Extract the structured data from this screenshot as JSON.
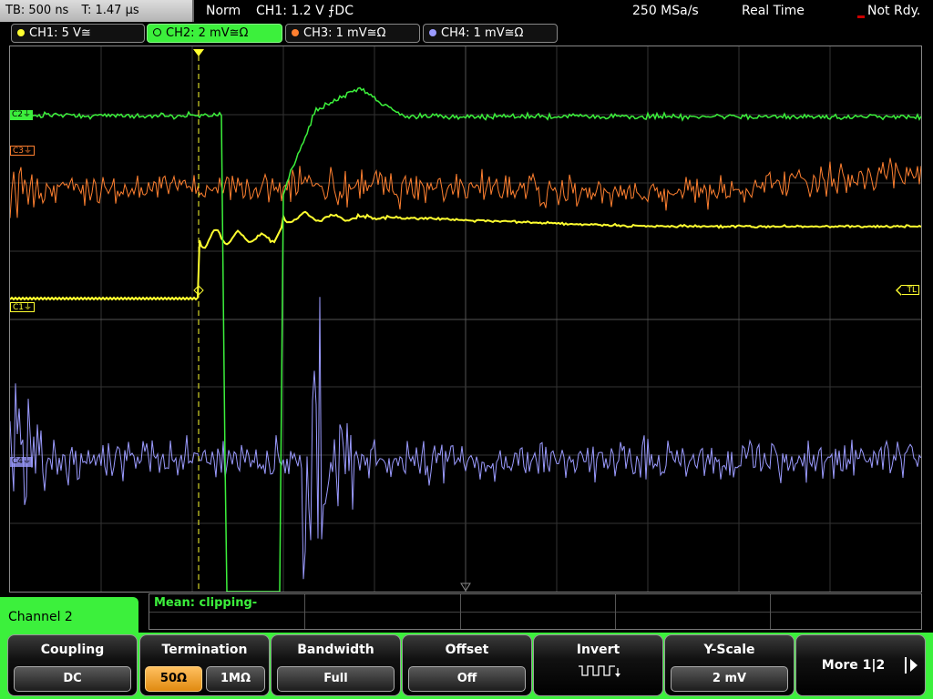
{
  "header": {
    "timebase": "TB: 500 ns",
    "trigger_time": "T: 1.47 µs",
    "trigger_mode": "Norm",
    "trigger_setting": "CH1: 1.2 V ⨍DC",
    "sample_rate": "250 MSa/s",
    "acq_mode": "Real Time",
    "status": "Not Rdy."
  },
  "channel_tabs": [
    {
      "label": "CH1: 5 V≅",
      "color": "#ffff30",
      "active": false
    },
    {
      "label": "CH2: 2 mV≅Ω",
      "color": "#3cf03c",
      "active": true
    },
    {
      "label": "CH3: 1 mV≅Ω",
      "color": "#ff8030",
      "active": false
    },
    {
      "label": "CH4: 1 mV≅Ω",
      "color": "#9b9bff",
      "active": false
    }
  ],
  "markers": {
    "c1": "C1⏚",
    "c2": "C2⏚",
    "c3": "C3⏚",
    "c4": "C4⏚",
    "tl": "TL",
    "trigger": "T"
  },
  "measurement": {
    "text": "Mean: clipping-"
  },
  "panel": {
    "channel_label": "Channel 2"
  },
  "softkeys": {
    "coupling": {
      "title": "Coupling",
      "value": "DC"
    },
    "termination": {
      "title": "Termination",
      "options": [
        "50Ω",
        "1MΩ"
      ],
      "selected": "50Ω"
    },
    "bandwidth": {
      "title": "Bandwidth",
      "value": "Full"
    },
    "offset": {
      "title": "Offset",
      "value": "Off"
    },
    "invert": {
      "title": "Invert",
      "icon": "pulse-train-invert-icon"
    },
    "yscale": {
      "title": "Y-Scale",
      "value": "2 mV"
    },
    "more": {
      "label": "More 1|2"
    }
  },
  "colors": {
    "ch1": "#ffff30",
    "ch2": "#3cf03c",
    "ch3": "#ff8030",
    "ch4": "#9b9bff",
    "accent": "#3cf03c"
  }
}
